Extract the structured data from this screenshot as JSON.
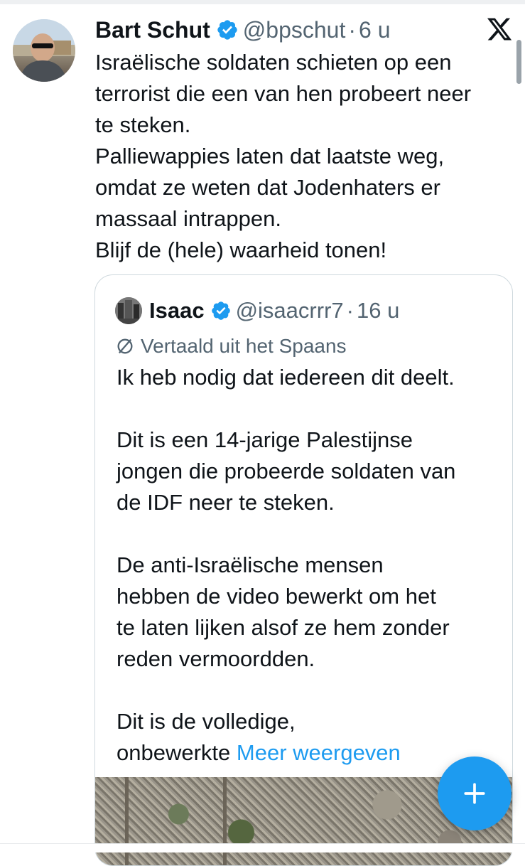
{
  "tweet": {
    "author_name": "Bart Schut",
    "handle": "@bpschut",
    "separator": "·",
    "time": "6 u",
    "text_lines": [
      "Israëlische soldaten schieten op een",
      "terrorist die een van hen probeert neer",
      "te steken.",
      "Palliewappies laten dat laatste weg,",
      "omdat ze weten dat Jodenhaters er",
      "massaal intrappen.",
      "Blijf de (hele) waarheid tonen!"
    ]
  },
  "quote": {
    "author_name": "Isaac",
    "handle": "@isaacrrr7",
    "separator": "·",
    "time": "16 u",
    "translated_label": "Vertaald uit het Spaans",
    "text_lines": [
      "Ik heb nodig dat iedereen dit deelt.",
      "",
      "Dit is een 14-jarige Palestijnse",
      "jongen die probeerde soldaten van",
      "de IDF neer te steken.",
      "",
      "De anti-Israëlische mensen",
      "hebben de video bewerkt om het",
      "te laten lijken alsof ze hem zonder",
      "reden vermoordden.",
      "",
      "Dit is de volledige,"
    ],
    "last_line_prefix": "onbewerkte ",
    "show_more_label": "Meer weergeven"
  },
  "icons": {
    "verified": "verified-badge-icon",
    "x_logo": "x-logo-icon",
    "translate": "translate-icon",
    "compose": "plus-icon"
  },
  "colors": {
    "accent": "#1d9bf0",
    "text": "#0f1419",
    "secondary": "#536471",
    "border": "#cfd9de"
  }
}
